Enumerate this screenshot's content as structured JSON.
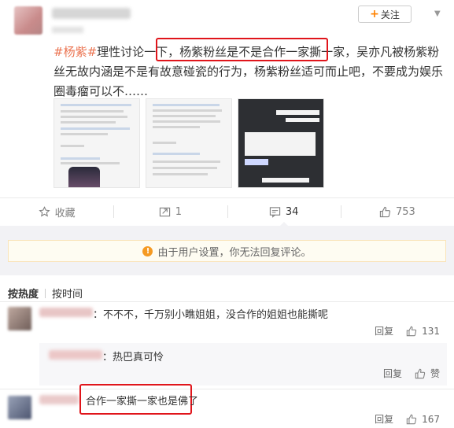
{
  "post": {
    "follow_label": "关注",
    "text_tag": "#杨紫#",
    "text_before": "理性讨论一下，",
    "text_highlight": "杨紫粉丝是不是合作一家撕一家",
    "text_after": "，吴亦凡被杨紫粉丝无故内涵是不是有故意碰瓷的行为，杨紫粉丝适可而止吧，不要成为娱乐圈毒瘤可以不……"
  },
  "actions": {
    "favorite_label": "收藏",
    "repost_count": "1",
    "comment_count": "34",
    "like_count": "753"
  },
  "notice": {
    "text": "由于用户设置，你无法回复评论。"
  },
  "sort": {
    "hot_label": "按热度",
    "time_label": "按时间"
  },
  "comments": [
    {
      "text": "：不不不，千万别小瞧姐姐，没合作的姐姐也能撕呢",
      "reply_label": "回复",
      "like_count": "131"
    },
    {
      "text": "：热巴真可怜",
      "reply_label": "回复",
      "like_count": "赞"
    },
    {
      "text": "合作一家撕一家也是佛了",
      "reply_label": "回复",
      "like_count": "167"
    }
  ],
  "colors": {
    "highlight_border": "#e0151b",
    "tag_color": "#eb7350",
    "follow_plus": "#ff8200",
    "notice_icon": "#f59a23"
  }
}
